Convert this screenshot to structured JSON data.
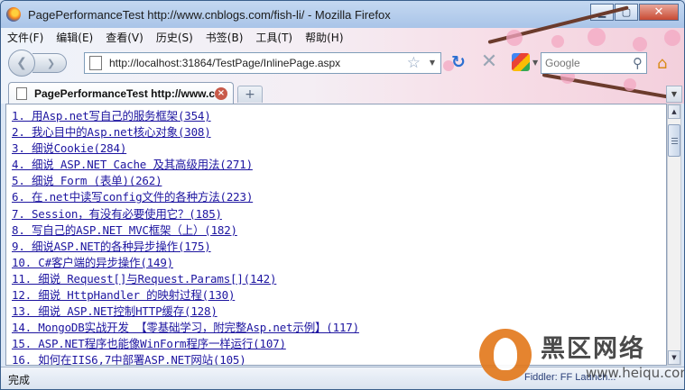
{
  "window": {
    "title": "PagePerformanceTest http://www.cnblogs.com/fish-li/ - Mozilla Firefox",
    "minimize_glyph": "▁",
    "maximize_glyph": "▢",
    "close_glyph": "✕",
    "icon": "firefox-logo-icon"
  },
  "menu": [
    "文件(F)",
    "编辑(E)",
    "查看(V)",
    "历史(S)",
    "书签(B)",
    "工具(T)",
    "帮助(H)"
  ],
  "nav": {
    "back_glyph": "❮",
    "forward_glyph": "❯",
    "url": "http://localhost:31864/TestPage/InlinePage.aspx",
    "star_glyph": "☆",
    "dropdown_glyph": "▼",
    "reload_glyph": "↻",
    "stop_glyph": "✕",
    "search_placeholder": "Google",
    "search_glyph": "⚲",
    "home_glyph": "⌂"
  },
  "tabs": [
    {
      "label": "PagePerformanceTest http://www.c...",
      "close_glyph": "×"
    }
  ],
  "new_tab_glyph": "+",
  "tab_list_glyph": "▼",
  "links": [
    "1. 用Asp.net写自己的服务框架(354)",
    "2. 我心目中的Asp.net核心对象(308)",
    "3. 细说Cookie(284)",
    "4. 细说 ASP.NET Cache 及其高级用法(271)",
    "5. 细说 Form (表单)(262)",
    "6. 在.net中读写config文件的各种方法(223)",
    "7. Session，有没有必要使用它？(185)",
    "8. 写自己的ASP.NET MVC框架（上）(182)",
    "9. 细说ASP.NET的各种异步操作(175)",
    "10. C#客户端的异步操作(149)",
    "11. 细说 Request[]与Request.Params[](142)",
    "12. 细说 HttpHandler 的映射过程(130)",
    "13. 细说 ASP.NET控制HTTP缓存(128)",
    "14. MongoDB实战开发 【零基础学习，附完整Asp.net示例】(117)",
    "15. ASP.NET程序也能像WinForm程序一样运行(107)",
    "16. 如何在IIS6,7中部署ASP.NET网站(105)"
  ],
  "scrollbar": {
    "up_glyph": "▲",
    "down_glyph": "▼"
  },
  "status": {
    "text": "完成",
    "fiddler": "Fiddler: FF Launch..."
  },
  "watermark": {
    "cn_text": "黑区网络",
    "url": "www.heiqu.com"
  }
}
